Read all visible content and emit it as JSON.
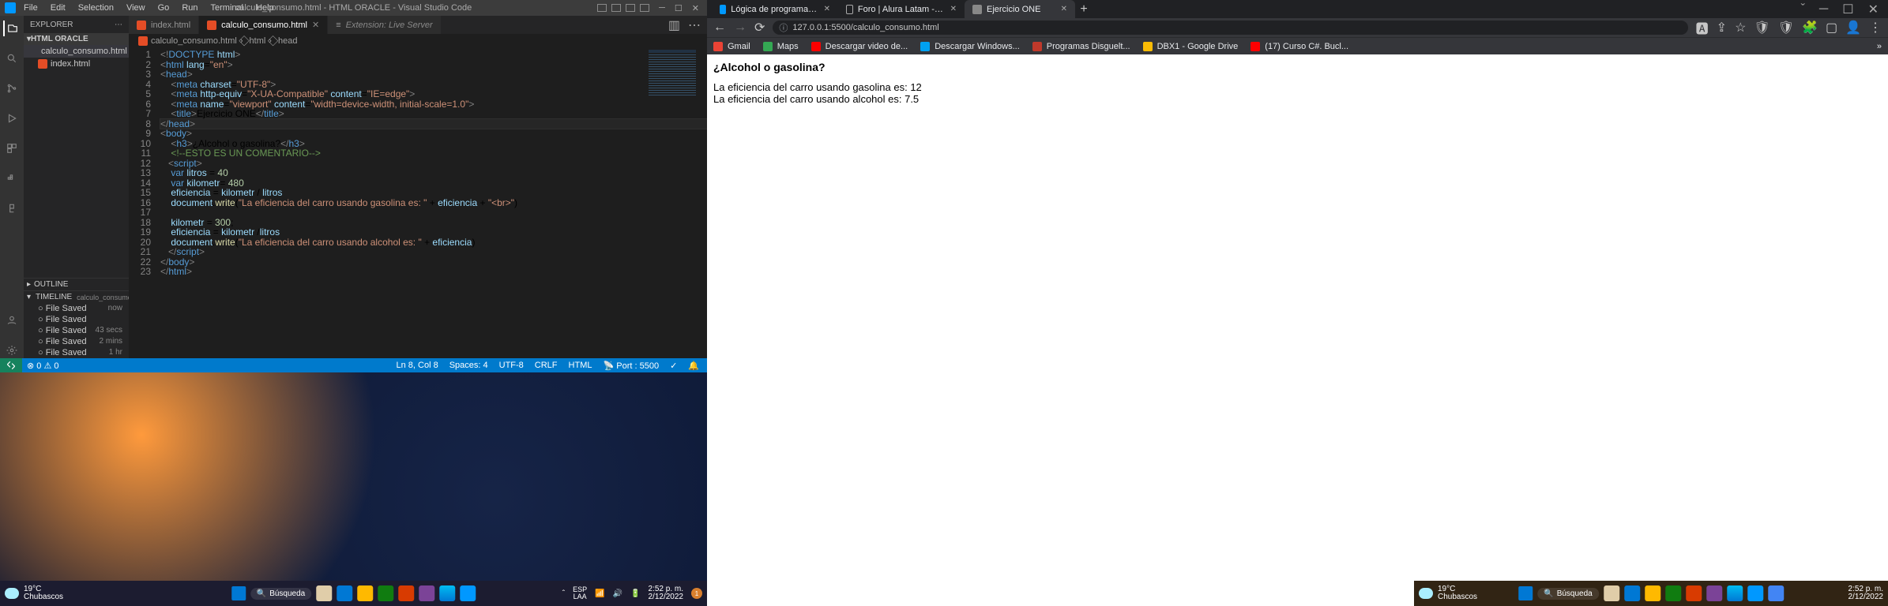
{
  "vscode": {
    "menu": [
      "File",
      "Edit",
      "Selection",
      "View",
      "Go",
      "Run",
      "Terminal",
      "Help"
    ],
    "title": "calculo_consumo.html - HTML ORACLE - Visual Studio Code",
    "explorer_label": "EXPLORER",
    "folder": "HTML ORACLE",
    "files": [
      "calculo_consumo.html",
      "index.html"
    ],
    "tabs": [
      {
        "label": "index.html"
      },
      {
        "label": "calculo_consumo.html"
      },
      {
        "label": "Extension: Live Server"
      }
    ],
    "breadcrumb": [
      "calculo_consumo.html",
      "html",
      "head"
    ],
    "code": [
      {
        "n": 1,
        "h": "<span class='c-d'>&lt;!</span><span class='c-t'>DOCTYPE</span> <span class='c-a'>html</span><span class='c-d'>&gt;</span>"
      },
      {
        "n": 2,
        "h": "<span class='c-d'>&lt;</span><span class='c-t'>html</span> <span class='c-a'>lang</span>=<span class='c-s'>\"en\"</span><span class='c-d'>&gt;</span>"
      },
      {
        "n": 3,
        "h": "<span class='c-d'>&lt;</span><span class='c-t'>head</span><span class='c-d'>&gt;</span>"
      },
      {
        "n": 4,
        "h": "    <span class='c-d'>&lt;</span><span class='c-t'>meta</span> <span class='c-a'>charset</span>=<span class='c-s'>\"UTF-8\"</span><span class='c-d'>&gt;</span>"
      },
      {
        "n": 5,
        "h": "    <span class='c-d'>&lt;</span><span class='c-t'>meta</span> <span class='c-a'>http-equiv</span>=<span class='c-s'>\"X-UA-Compatible\"</span> <span class='c-a'>content</span>=<span class='c-s'>\"IE=edge\"</span><span class='c-d'>&gt;</span>"
      },
      {
        "n": 6,
        "h": "    <span class='c-d'>&lt;</span><span class='c-t'>meta</span> <span class='c-a'>name</span>=<span class='c-s'>\"viewport\"</span> <span class='c-a'>content</span>=<span class='c-s'>\"width=device-width, initial-scale=1.0\"</span><span class='c-d'>&gt;</span>"
      },
      {
        "n": 7,
        "h": "    <span class='c-d'>&lt;</span><span class='c-t'>title</span><span class='c-d'>&gt;</span>Ejercicio ONE<span class='c-d'>&lt;/</span><span class='c-t'>title</span><span class='c-d'>&gt;</span>"
      },
      {
        "n": 8,
        "h": "<span class='c-d'>&lt;/</span><span class='c-t'>head</span><span class='c-d'>&gt;</span>",
        "hl": true
      },
      {
        "n": 9,
        "h": "<span class='c-d'>&lt;</span><span class='c-t'>body</span><span class='c-d'>&gt;</span>"
      },
      {
        "n": 10,
        "h": "    <span class='c-d'>&lt;</span><span class='c-t'>h3</span><span class='c-d'>&gt;</span>¿Alcohol o gasolina?<span class='c-d'>&lt;/</span><span class='c-t'>h3</span><span class='c-d'>&gt;</span>"
      },
      {
        "n": 11,
        "h": "    <span class='c-c'>&lt;!--ESTO ES UN COMENTARIO--&gt;</span>"
      },
      {
        "n": 12,
        "h": "   <span class='c-d'>&lt;</span><span class='c-t'>script</span><span class='c-d'>&gt;</span>"
      },
      {
        "n": 13,
        "h": "    <span class='c-k'>var</span> <span class='c-a'>litros</span> = <span class='c-n'>40</span>"
      },
      {
        "n": 14,
        "h": "    <span class='c-k'>var</span> <span class='c-a'>kilometr</span>= <span class='c-n'>480</span>"
      },
      {
        "n": 15,
        "h": "    <span class='c-a'>eficiencia</span> = <span class='c-a'>kilometr</span> / <span class='c-a'>litros</span>"
      },
      {
        "n": 16,
        "h": "    <span class='c-a'>document</span>.<span class='c-fn'>write</span>(<span class='c-s'>\"La eficiencia del carro usando gasolina es: \"</span> + <span class='c-a'>eficiencia</span> + <span class='c-s'>\"&lt;br&gt;\"</span>)"
      },
      {
        "n": 17,
        "h": ""
      },
      {
        "n": 18,
        "h": "    <span class='c-a'>kilometr</span> = <span class='c-n'>300</span>;"
      },
      {
        "n": 19,
        "h": "    <span class='c-a'>eficiencia</span> = <span class='c-a'>kilometr</span> /<span class='c-a'>litros</span>"
      },
      {
        "n": 20,
        "h": "    <span class='c-a'>document</span>.<span class='c-fn'>write</span>(<span class='c-s'>\"La eficiencia del carro usando alcohol es: \"</span> + <span class='c-a'>eficiencia</span>)"
      },
      {
        "n": 21,
        "h": "   <span class='c-d'>&lt;/</span><span class='c-t'>script</span><span class='c-d'>&gt;</span>"
      },
      {
        "n": 22,
        "h": "<span class='c-d'>&lt;/</span><span class='c-t'>body</span><span class='c-d'>&gt;</span>"
      },
      {
        "n": 23,
        "h": "<span class='c-d'>&lt;/</span><span class='c-t'>html</span><span class='c-d'>&gt;</span>"
      }
    ],
    "outline": "OUTLINE",
    "timeline": {
      "label": "TIMELINE",
      "file": "calculo_consumo.html",
      "items": [
        {
          "t": "File Saved",
          "time": "now"
        },
        {
          "t": "File Saved",
          "time": ""
        },
        {
          "t": "File Saved",
          "time": "43 secs"
        },
        {
          "t": "File Saved",
          "time": "2 mins"
        },
        {
          "t": "File Saved",
          "time": "1 hr"
        }
      ]
    },
    "status": {
      "errors": "0",
      "warnings": "0",
      "ln": "Ln 8, Col 8",
      "spaces": "Spaces: 4",
      "enc": "UTF-8",
      "eol": "CRLF",
      "lang": "HTML",
      "port": "Port : 5500"
    }
  },
  "browser": {
    "tabs": [
      {
        "label": "Lógica de programación: Primero"
      },
      {
        "label": "Foro | Alura Latam - Cursos onlin"
      },
      {
        "label": "Ejercicio ONE"
      }
    ],
    "url": "127.0.0.1:5500/calculo_consumo.html",
    "bookmarks": [
      {
        "label": "Gmail",
        "cls": "bm-g"
      },
      {
        "label": "Maps",
        "cls": "bm-m"
      },
      {
        "label": "Descargar video de...",
        "cls": "bm-y"
      },
      {
        "label": "Descargar Windows...",
        "cls": "bm-w"
      },
      {
        "label": "Programas Disguelt...",
        "cls": "bm-p"
      },
      {
        "label": "DBX1 - Google Drive",
        "cls": "bm-d"
      },
      {
        "label": "(17) Curso C#. Bucl...",
        "cls": "bm-c"
      }
    ],
    "page": {
      "h3": "¿Alcohol o gasolina?",
      "line1": "La eficiencia del carro usando gasolina es: 12",
      "line2": "La eficiencia del carro usando alcohol es: 7.5"
    }
  },
  "taskbar": {
    "temp": "19°C",
    "cond": "Chubascos",
    "search": "Búsqueda",
    "lang1": "ESP",
    "lang2": "LAA",
    "time": "2:52 p. m.",
    "date": "2/12/2022",
    "notif": "1"
  }
}
